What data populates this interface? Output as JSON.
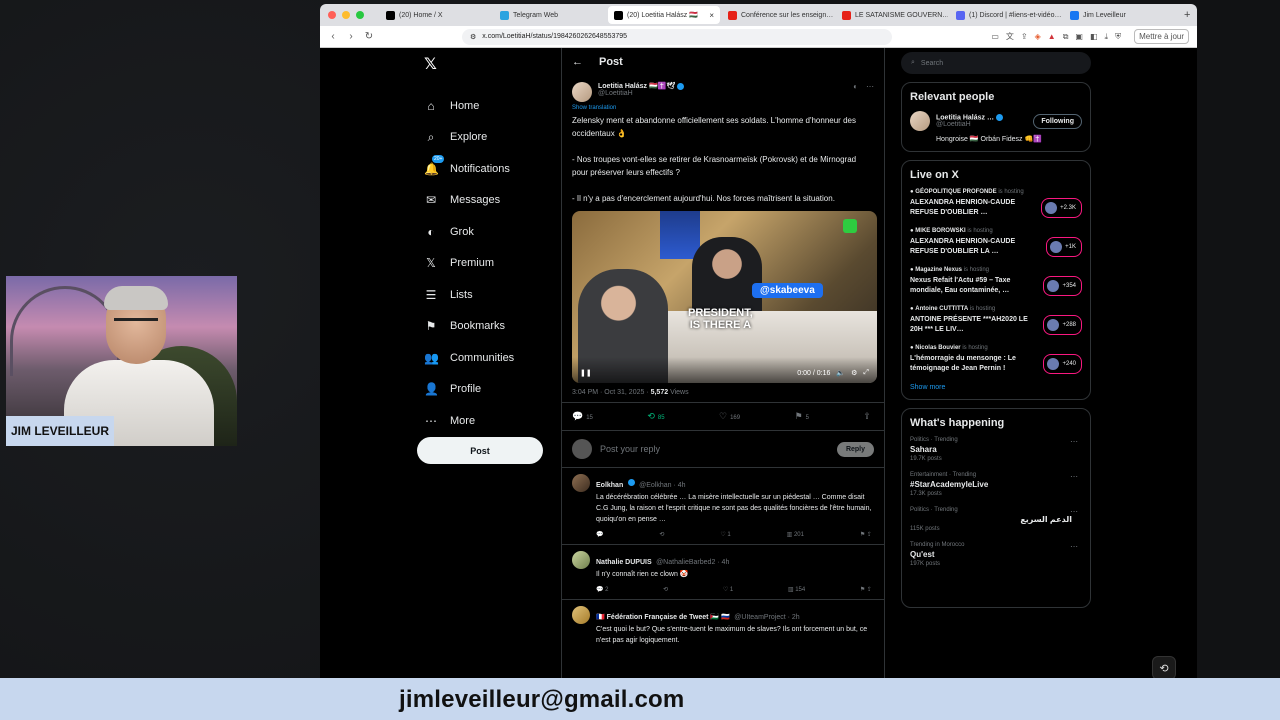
{
  "browser": {
    "tabs": [
      {
        "label": "(20) Home / X",
        "active": false,
        "color": "#000000"
      },
      {
        "label": "Telegram Web",
        "active": false,
        "color": "#2aa3e0"
      },
      {
        "label": "(20) Loetitia Halász 🇭🇺",
        "active": true,
        "color": "#000000"
      },
      {
        "label": "Conférence sur les enseign…",
        "active": false,
        "color": "#e62117"
      },
      {
        "label": "LE SATANISME GOUVERN…",
        "active": false,
        "color": "#e62117"
      },
      {
        "label": "(1) Discord | #liens-et-vidéo…",
        "active": false,
        "color": "#5865f2"
      },
      {
        "label": "Jim Leveilleur",
        "active": false,
        "color": "#1877f2"
      }
    ],
    "url": "x.com/LoetitiaH/status/1984260262648553795",
    "update_label": "Mettre à jour"
  },
  "nav": {
    "items": [
      {
        "label": "Home",
        "icon": "home-icon",
        "glyph": "⌂"
      },
      {
        "label": "Explore",
        "icon": "search-icon",
        "glyph": "⌕"
      },
      {
        "label": "Notifications",
        "icon": "bell-icon",
        "glyph": "🔔"
      },
      {
        "label": "Messages",
        "icon": "mail-icon",
        "glyph": "✉"
      },
      {
        "label": "Grok",
        "icon": "grok-icon",
        "glyph": "◐"
      },
      {
        "label": "Premium",
        "icon": "x-icon",
        "glyph": "𝕏"
      },
      {
        "label": "Lists",
        "icon": "list-icon",
        "glyph": "☰"
      },
      {
        "label": "Bookmarks",
        "icon": "bookmark-icon",
        "glyph": "⚑"
      },
      {
        "label": "Communities",
        "icon": "people-icon",
        "glyph": "👥"
      },
      {
        "label": "Profile",
        "icon": "user-icon",
        "glyph": "👤"
      },
      {
        "label": "More",
        "icon": "more-icon",
        "glyph": "⋯"
      }
    ],
    "notif_badge": "20+",
    "post_button": "Post"
  },
  "main": {
    "header_title": "Post",
    "author_name": "Loetitia Halász 🇭🇺✝️🕊",
    "author_handle": "@LoetitiaH",
    "show_translation": "Show translation",
    "text": "Zelensky ment et abandonne officiellement ses soldats. L'homme d'honneur des occidentaux 👌\n\n- Nos troupes vont-elles se retirer de Krasnoarmeïsk (Pokrovsk) et de Mirnograd pour préserver leurs effectifs ?\n\n- Il n'y a pas d'encerclement aujourd'hui. Nos forces maîtrisent la situation.",
    "video": {
      "tag": "@skabeeva",
      "caption": "PRESIDENT,\nIS THERE A",
      "time": "0:00 / 0:16"
    },
    "meta_time": "3:04 PM · Oct 31, 2025 · ",
    "meta_views_num": "5,572",
    "meta_views_label": " Views",
    "actions": {
      "replies": "15",
      "reposts": "85",
      "likes": "169",
      "bookmarks": "5"
    },
    "reply_placeholder": "Post your reply",
    "reply_button": "Reply",
    "replies": [
      {
        "name": "Eolkhan",
        "handle": "@Eolkhan · 4h",
        "text": "La décérébration célébrée … La misère intellectuelle sur un piédestal … Comme disait C.G Jung, la raison et l'esprit critique ne sont pas des qualités foncières de l'être humain, quoiqu'on en pense …",
        "likes": "1",
        "views": "201"
      },
      {
        "name": "Nathalie DUPUIS",
        "handle": "@NathalieBarbed2 · 4h",
        "text": "Il n'y connaît rien ce clown 🤡",
        "replies": "2",
        "likes": "1",
        "views": "154"
      },
      {
        "name": "🇫🇷 Fédération Française de Tweet 🇵🇸 🇷🇺",
        "handle": "@UIteamProject · 2h",
        "text": "C'est quoi le but? Que s'entre-tuent le maximum de slaves? Ils ont forcement un but, ce n'est pas agir logiquement."
      }
    ]
  },
  "right": {
    "search_placeholder": "Search",
    "relevant_title": "Relevant people",
    "relevant_name": "Loetitia Halász …",
    "relevant_handle": "@LoetitiaH",
    "follow_label": "Following",
    "relevant_bio": "Hongroise 🇭🇺 Orbán Fidesz 👊✝️",
    "live_title": "Live on X",
    "live": [
      {
        "host": "GÉOPOLITIQUE PROFONDE",
        "status": "is hosting",
        "title": "ALEXANDRA HENRION-CAUDE REFUSE D'OUBLIER …",
        "count": "+2.3K"
      },
      {
        "host": "MIKE BOROWSKI",
        "status": "is hosting",
        "title": "ALEXANDRA HENRION-CAUDE REFUSE D'OUBLIER LA …",
        "count": "+1K"
      },
      {
        "host": "Magazine Nexus",
        "status": "is hosting",
        "title": "Nexus Refait l'Actu #59 – Taxe mondiale, Eau contaminée, …",
        "count": "+354"
      },
      {
        "host": "Antoine CUTTITTA",
        "status": "is hosting",
        "title": "ANTOINE PRÉSENTE ***AH2020 LE 20H *** LE LIV…",
        "count": "+288"
      },
      {
        "host": "Nicolas Bouvier",
        "status": "is hosting",
        "title": "L'hémorragie du mensonge : Le témoignage de Jean Pernin !",
        "count": "+240"
      }
    ],
    "show_more": "Show more",
    "happening_title": "What's happening",
    "trends": [
      {
        "category": "Politics · Trending",
        "name": "Sahara",
        "posts": "19.7K posts"
      },
      {
        "category": "Entertainment · Trending",
        "name": "#StarAcademyleLive",
        "posts": "17.3K posts"
      },
      {
        "category": "Politics · Trending",
        "name": "الدعم السريع",
        "posts": "115K posts"
      },
      {
        "category": "Trending in Morocco",
        "name": "Qu'est",
        "posts": "197K posts"
      }
    ]
  },
  "webcam": {
    "label": "JIM LEVEILLEUR"
  },
  "banner": {
    "email": "jimleveilleur@gmail.com"
  }
}
